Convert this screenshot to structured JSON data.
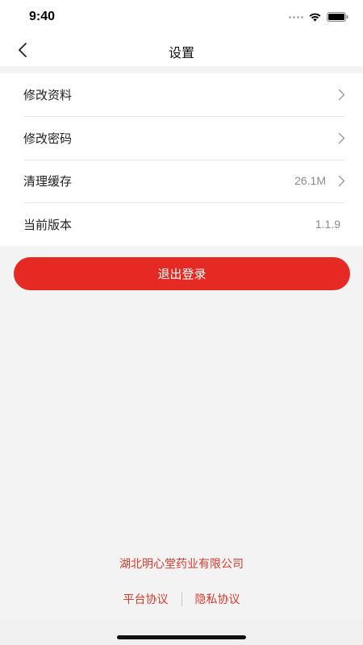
{
  "status_bar": {
    "time": "9:40"
  },
  "nav": {
    "title": "设置"
  },
  "settings": {
    "items": [
      {
        "label": "修改资料",
        "value": ""
      },
      {
        "label": "修改密码",
        "value": ""
      },
      {
        "label": "清理缓存",
        "value": "26.1M"
      },
      {
        "label": "当前版本",
        "value": "1.1.9"
      }
    ]
  },
  "actions": {
    "logout_label": "退出登录"
  },
  "footer": {
    "company": "湖北明心堂药业有限公司",
    "platform_agreement": "平台协议",
    "privacy_agreement": "隐私协议"
  },
  "colors": {
    "accent": "#e42a22",
    "footer_text": "#d83a2c",
    "background": "#f3f3f3"
  }
}
